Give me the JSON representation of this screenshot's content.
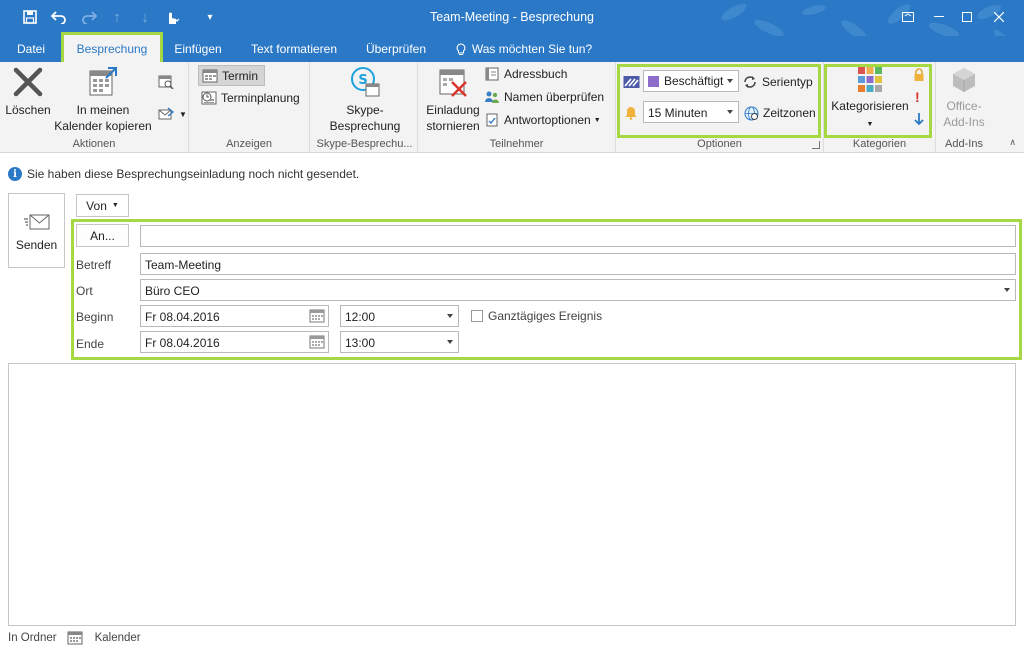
{
  "window": {
    "title": "Team-Meeting - Besprechung",
    "accent": "#2b79c6",
    "highlight": "#a5d842"
  },
  "quick_access": {
    "icons": [
      "save-icon",
      "undo-icon",
      "redo-icon",
      "up-arrow-icon",
      "down-arrow-icon",
      "touch-mode-icon",
      "customize-icon"
    ]
  },
  "tabs": [
    {
      "label": "Datei"
    },
    {
      "label": "Besprechung",
      "active": true
    },
    {
      "label": "Einfügen"
    },
    {
      "label": "Text formatieren"
    },
    {
      "label": "Überprüfen"
    },
    {
      "label": "Was möchten Sie tun?"
    }
  ],
  "ribbon": {
    "aktionen": {
      "label": "Aktionen",
      "delete": "Löschen",
      "copy_line1": "In meinen",
      "copy_line2": "Kalender kopieren"
    },
    "anzeigen": {
      "label": "Anzeigen",
      "termin": "Termin",
      "terminplanung": "Terminplanung"
    },
    "skype": {
      "label": "Skype-Besprechu...",
      "btn_line1": "Skype-",
      "btn_line2": "Besprechung"
    },
    "teilnehmer": {
      "label": "Teilnehmer",
      "cancel_line1": "Einladung",
      "cancel_line2": "stornieren",
      "adressbuch": "Adressbuch",
      "namen": "Namen überprüfen",
      "antwort": "Antwortoptionen"
    },
    "optionen": {
      "label": "Optionen",
      "status": "Beschäftigt",
      "status_color": "#8e6cc9",
      "reminder": "15 Minuten",
      "serientyp": "Serientyp",
      "zeitzonen": "Zeitzonen"
    },
    "kategorien": {
      "label": "Kategorien",
      "kategorisieren": "Kategorisieren"
    },
    "addins": {
      "label": "Add-Ins",
      "line1": "Office-",
      "line2": "Add-Ins"
    }
  },
  "info_message": "Sie haben diese Besprechungseinladung noch nicht gesendet.",
  "form": {
    "send": "Senden",
    "from": "Von",
    "to_button": "An...",
    "to_value": "",
    "subject_label": "Betreff",
    "subject_value": "Team-Meeting",
    "location_label": "Ort",
    "location_value": "Büro CEO",
    "start_label": "Beginn",
    "start_date": "Fr 08.04.2016",
    "start_time": "12:00",
    "allday_label": "Ganztägiges Ereignis",
    "end_label": "Ende",
    "end_date": "Fr 08.04.2016",
    "end_time": "13:00"
  },
  "footer": {
    "folder_label": "In Ordner",
    "folder_name": "Kalender"
  }
}
